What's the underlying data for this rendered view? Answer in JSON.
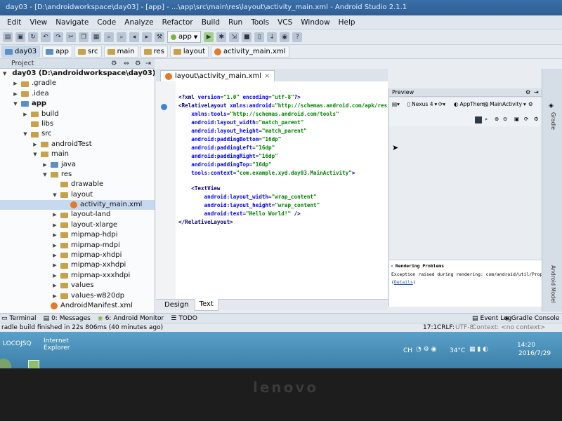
{
  "window": {
    "title": "day03 - [D:\\androidworkspace\\day03] - [app] - ...\\app\\src\\main\\res\\layout\\activity_main.xml - Android Studio 2.1.1"
  },
  "menu": [
    "Edit",
    "View",
    "Navigate",
    "Code",
    "Analyze",
    "Refactor",
    "Build",
    "Run",
    "Tools",
    "VCS",
    "Window",
    "Help"
  ],
  "breadcrumb": [
    "day03",
    "app",
    "src",
    "main",
    "res",
    "layout",
    "activity_main.xml"
  ],
  "toolbar": {
    "run_config": "app"
  },
  "project_panel": {
    "header": "Project",
    "tree": [
      {
        "label": "day03 (D:\\androidworkspace\\day03)",
        "depth": 0,
        "expanded": true,
        "icon": "folder-blue"
      },
      {
        "label": ".gradle",
        "depth": 1,
        "expanded": false,
        "icon": "folder"
      },
      {
        "label": ".idea",
        "depth": 1,
        "expanded": false,
        "icon": "folder"
      },
      {
        "label": "app",
        "depth": 1,
        "expanded": true,
        "icon": "folder-blue"
      },
      {
        "label": "build",
        "depth": 2,
        "expanded": false,
        "icon": "folder"
      },
      {
        "label": "libs",
        "depth": 2,
        "expanded": null,
        "icon": "folder"
      },
      {
        "label": "src",
        "depth": 2,
        "expanded": true,
        "icon": "folder"
      },
      {
        "label": "androidTest",
        "depth": 3,
        "expanded": false,
        "icon": "folder"
      },
      {
        "label": "main",
        "depth": 3,
        "expanded": true,
        "icon": "folder"
      },
      {
        "label": "java",
        "depth": 4,
        "expanded": false,
        "icon": "folder-blue"
      },
      {
        "label": "res",
        "depth": 4,
        "expanded": true,
        "icon": "folder"
      },
      {
        "label": "drawable",
        "depth": 5,
        "expanded": null,
        "icon": "folder"
      },
      {
        "label": "layout",
        "depth": 5,
        "expanded": true,
        "icon": "folder"
      },
      {
        "label": "activity_main.xml",
        "depth": 6,
        "expanded": null,
        "icon": "xml-file",
        "selected": true
      },
      {
        "label": "layout-land",
        "depth": 5,
        "expanded": false,
        "icon": "folder"
      },
      {
        "label": "layout-xlarge",
        "depth": 5,
        "expanded": false,
        "icon": "folder"
      },
      {
        "label": "mipmap-hdpi",
        "depth": 5,
        "expanded": false,
        "icon": "folder"
      },
      {
        "label": "mipmap-mdpi",
        "depth": 5,
        "expanded": false,
        "icon": "folder"
      },
      {
        "label": "mipmap-xhdpi",
        "depth": 5,
        "expanded": false,
        "icon": "folder"
      },
      {
        "label": "mipmap-xxhdpi",
        "depth": 5,
        "expanded": false,
        "icon": "folder"
      },
      {
        "label": "mipmap-xxxhdpi",
        "depth": 5,
        "expanded": false,
        "icon": "folder"
      },
      {
        "label": "values",
        "depth": 5,
        "expanded": false,
        "icon": "folder"
      },
      {
        "label": "values-w820dp",
        "depth": 5,
        "expanded": false,
        "icon": "folder"
      },
      {
        "label": "AndroidManifest.xml",
        "depth": 4,
        "expanded": null,
        "icon": "manifest-file"
      }
    ]
  },
  "editor": {
    "tab_label": "layout\\activity_main.xml",
    "lines": [
      [
        {
          "t": "<?",
          "c": "tag"
        },
        {
          "t": "xml ",
          "c": "tag"
        },
        {
          "t": "version",
          "c": "att"
        },
        {
          "t": "=",
          "c": "plain"
        },
        {
          "t": "\"1.0\" ",
          "c": "val"
        },
        {
          "t": "encoding",
          "c": "att"
        },
        {
          "t": "=",
          "c": "plain"
        },
        {
          "t": "\"utf-8\"",
          "c": "val"
        },
        {
          "t": "?>",
          "c": "tag"
        }
      ],
      [
        {
          "t": "<RelativeLayout ",
          "c": "tag"
        },
        {
          "t": "xmlns:android",
          "c": "att"
        },
        {
          "t": "=",
          "c": "plain"
        },
        {
          "t": "\"http://schemas.android.com/apk/res/android\"",
          "c": "val"
        }
      ],
      [
        {
          "t": "    xmlns:tools",
          "c": "att"
        },
        {
          "t": "=",
          "c": "plain"
        },
        {
          "t": "\"http://schemas.android.com/tools\"",
          "c": "val"
        }
      ],
      [
        {
          "t": "    android:layout_width",
          "c": "att"
        },
        {
          "t": "=",
          "c": "plain"
        },
        {
          "t": "\"match_parent\"",
          "c": "val"
        }
      ],
      [
        {
          "t": "    android:layout_height",
          "c": "att"
        },
        {
          "t": "=",
          "c": "plain"
        },
        {
          "t": "\"match_parent\"",
          "c": "val"
        }
      ],
      [
        {
          "t": "    android:paddingBottom",
          "c": "att"
        },
        {
          "t": "=",
          "c": "plain"
        },
        {
          "t": "\"16dp\"",
          "c": "val"
        }
      ],
      [
        {
          "t": "    android:paddingLeft",
          "c": "att"
        },
        {
          "t": "=",
          "c": "plain"
        },
        {
          "t": "\"16dp\"",
          "c": "val"
        }
      ],
      [
        {
          "t": "    android:paddingRight",
          "c": "att"
        },
        {
          "t": "=",
          "c": "plain"
        },
        {
          "t": "\"16dp\"",
          "c": "val"
        }
      ],
      [
        {
          "t": "    android:paddingTop",
          "c": "att"
        },
        {
          "t": "=",
          "c": "plain"
        },
        {
          "t": "\"16dp\"",
          "c": "val"
        }
      ],
      [
        {
          "t": "    tools:context",
          "c": "att"
        },
        {
          "t": "=",
          "c": "plain"
        },
        {
          "t": "\"com.example.xyd.day03.MainActivity\"",
          "c": "val"
        },
        {
          "t": ">",
          "c": "tag"
        }
      ],
      [],
      [
        {
          "t": "    <TextView",
          "c": "tag"
        }
      ],
      [
        {
          "t": "        android:layout_width",
          "c": "att"
        },
        {
          "t": "=",
          "c": "plain"
        },
        {
          "t": "\"wrap_content\"",
          "c": "val"
        }
      ],
      [
        {
          "t": "        android:layout_height",
          "c": "att"
        },
        {
          "t": "=",
          "c": "plain"
        },
        {
          "t": "\"wrap_content\"",
          "c": "val"
        }
      ],
      [
        {
          "t": "        android:text",
          "c": "att"
        },
        {
          "t": "=",
          "c": "plain"
        },
        {
          "t": "\"Hello World!\" ",
          "c": "val"
        },
        {
          "t": "/>",
          "c": "tag"
        }
      ],
      [
        {
          "t": "</RelativeLayout>",
          "c": "tag"
        }
      ]
    ],
    "bottom_tabs": [
      "Design",
      "Text"
    ],
    "active_bottom_tab": "Text"
  },
  "preview": {
    "header": "Preview",
    "device": "Nexus 4",
    "theme": "AppTheme",
    "activity": "MainActivity",
    "render_problems_title": "Rendering Problems",
    "render_problems_text": "Exception raised during rendering: com/android/util/PropertiesMap",
    "details_link": "Details"
  },
  "right_strip": [
    "Gradle",
    "Android Model"
  ],
  "tool_windows": [
    "Terminal",
    "0: Messages",
    "6: Android Monitor",
    "TODO",
    "Event Log",
    "Gradle Console"
  ],
  "status": {
    "message": "radle build finished in 22s 806ms (40 minutes ago)",
    "position": "17:1",
    "line_sep": "CRLF:",
    "encoding": "UTF-8",
    "context": "Context: <no context>"
  },
  "taskbar": {
    "left_label": "LOCOJSQ",
    "ie_label": "Internet Explorer",
    "ime": "CH",
    "temp": "34°C",
    "time": "14:20",
    "date": "2016/7/29"
  },
  "monitor": {
    "brand": "lenovo"
  }
}
